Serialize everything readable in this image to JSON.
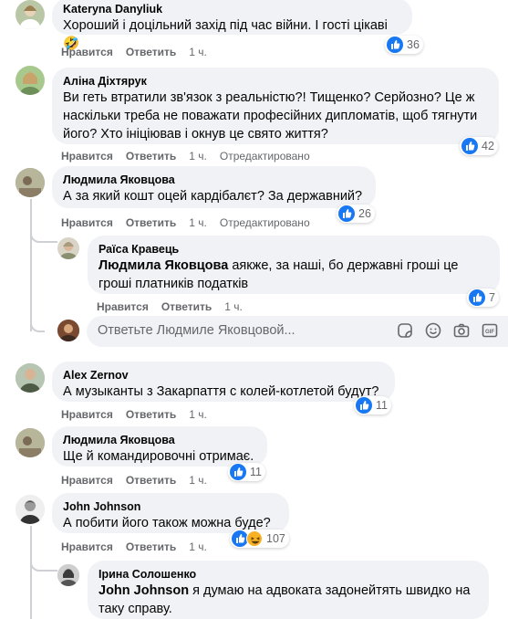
{
  "action_labels": {
    "like": "Нравится",
    "reply": "Ответить",
    "edited": "Отредактировано"
  },
  "comments": [
    {
      "author": "Kateryna Danyliuk",
      "text": "Хороший і доцільний захід під час війни. І гості цікаві🤣",
      "time": "1 ч.",
      "reactions": "36"
    },
    {
      "author": "Аліна Діхтярук",
      "text": "Ви геть втратили зв'язок з реальністю?! Тищенко? Серйозно? Це ж наскільки треба не поважати професійних дипломатів, щоб тягнути його? Хто ініціював і окнув це свято життя?",
      "time": "1 ч.",
      "reactions": "42"
    },
    {
      "author": "Людмила Яковцова",
      "text": "А за який кошт оцей кардібалєт? За державний?",
      "time": "1 ч.",
      "reactions": "26"
    },
    {
      "author": "Alex Zernov",
      "text": "А музыканты з Закарпаття с колей-котлетой будут?",
      "time": "1 ч.",
      "reactions": "11"
    },
    {
      "author": "Людмила Яковцова",
      "text": "Ще й командировочні отримає.",
      "time": "1 ч.",
      "reactions": "11"
    },
    {
      "author": "John Johnson",
      "text": "А побити його також можна буде?",
      "time": "1 ч.",
      "reactions": "107"
    }
  ],
  "replies": [
    {
      "author": "Раїса Кравець",
      "mention": "Людмила Яковцова",
      "text": " аякже, за наші, бо державні гроші це гроші платників податків",
      "time": "1 ч.",
      "reactions": "7"
    },
    {
      "author": "Ірина Солошенко",
      "mention": "John Johnson",
      "text": " я думаю на адвоката задонейтять швидко на таку справу."
    }
  ],
  "reply_input": {
    "placeholder": "Ответьте Людмиле Яковцовой..."
  },
  "icons": [
    "like-icon",
    "haha-icon",
    "emoji-icon",
    "camera-icon",
    "gif-icon",
    "sticker-icon"
  ],
  "colors": {
    "like": "#1877f2",
    "bubble": "#f0f2f5",
    "meta": "#65676b"
  }
}
